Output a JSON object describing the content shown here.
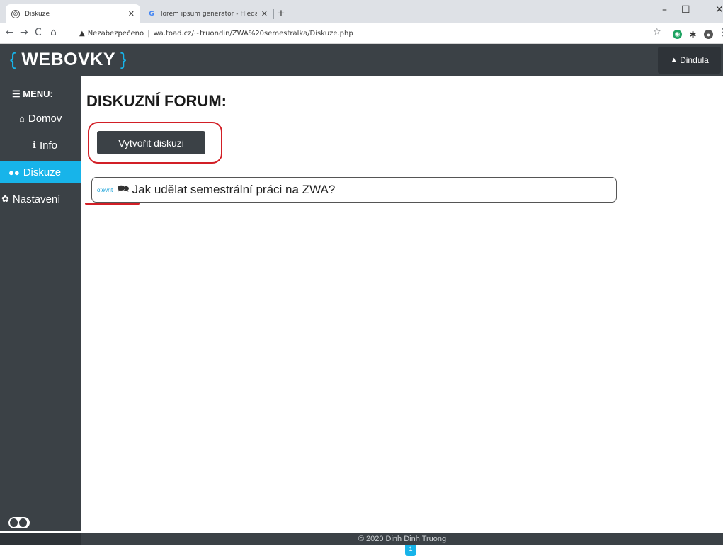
{
  "browser": {
    "tabs": [
      {
        "title": "Diskuze",
        "icon": "globe-icon",
        "active": true
      },
      {
        "title": "lorem ipsum generator - Hledat",
        "icon": "google-icon",
        "active": false
      }
    ],
    "new_tab": "+",
    "security_label": "Nezabezpečeno",
    "url": "wa.toad.cz/~truondin/ZWA%20semestrálka/Diskuze.php"
  },
  "app": {
    "logo_left": "{",
    "logo_text": "WEBOVKY",
    "logo_right": "}",
    "user_name": "Dindula",
    "accent_color": "#17b4ea",
    "dark_color": "#3b4146"
  },
  "sidebar": {
    "menu_title": "MENU:",
    "items": [
      {
        "label": "Domov",
        "icon": "home-icon",
        "active": false
      },
      {
        "label": "Info",
        "icon": "info-icon",
        "active": false
      },
      {
        "label": "Diskuze",
        "icon": "users-icon",
        "active": true
      },
      {
        "label": "Nastavení",
        "icon": "gear-icon",
        "active": false
      }
    ]
  },
  "main": {
    "heading": "DISKUZNÍ FORUM:",
    "create_button": "Vytvořit diskuzi",
    "threads": [
      {
        "open_link": "otevřít",
        "title": "Jak udělat semestrální práci na ZWA?"
      }
    ],
    "current_page": "1"
  },
  "footer": {
    "text": "© 2020 Dinh Dinh Truong"
  }
}
